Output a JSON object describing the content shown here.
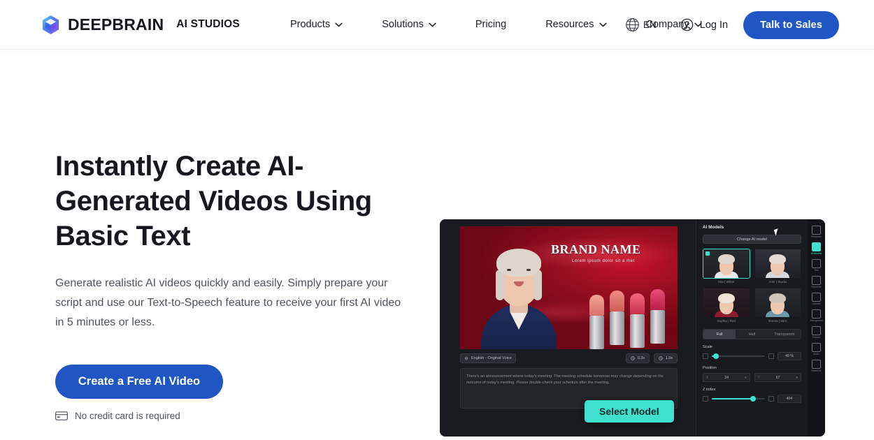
{
  "header": {
    "brand": {
      "name": "DEEPBRAIN",
      "sub": "AI STUDIOS",
      "logo_icon": "cube-logo-icon"
    },
    "nav": [
      {
        "label": "Products",
        "has_dropdown": true
      },
      {
        "label": "Solutions",
        "has_dropdown": true
      },
      {
        "label": "Pricing",
        "has_dropdown": false
      },
      {
        "label": "Resources",
        "has_dropdown": true
      },
      {
        "label": "Company",
        "has_dropdown": true
      }
    ],
    "language": {
      "label": "EN",
      "icon": "globe-icon"
    },
    "login": {
      "label": "Log In",
      "icon": "user-circle-icon"
    },
    "cta": {
      "label": "Talk to Sales"
    }
  },
  "hero": {
    "title": "Instantly Create AI-Generated Videos Using Basic Text",
    "subtitle": "Generate realistic AI videos quickly and easily. Simply prepare your script and use our Text-to-Speech feature to receive your first AI video in 5 minutes or less.",
    "cta": {
      "label": "Create a Free AI Video"
    },
    "note": {
      "label": "No credit card is required",
      "icon": "credit-card-icon"
    }
  },
  "editor": {
    "stage": {
      "brand_name": "BRAND NAME",
      "brand_tagline": "Lorem ipsum dolor sit a met"
    },
    "toolbar": {
      "language_tag": "English - Original Voice",
      "duration_a": "0.3s",
      "duration_b": "1.0s"
    },
    "script": "There's an announcement where today's meeting. The meeting schedule tomorrow may change depending on the outcome of today's meeting. Please double-check your schedule after the meeting.",
    "select_model_button": "Select Model",
    "panel": {
      "title": "AI Models",
      "change_button": "Change AI model",
      "models": [
        {
          "name": "Mia | White",
          "selected": true
        },
        {
          "name": "Ariel | Studio",
          "selected": false
        },
        {
          "name": "Sophia | Red",
          "selected": false
        },
        {
          "name": "Emma | Mint",
          "selected": false
        }
      ],
      "segments": [
        {
          "label": "Full",
          "active": true
        },
        {
          "label": "Half",
          "active": false
        },
        {
          "label": "Transparent",
          "active": false
        }
      ],
      "scale": {
        "label": "Scale",
        "value": "49 %",
        "percent": 8
      },
      "position": {
        "label": "Position",
        "x_key": "X",
        "x_value": "24",
        "y_key": "Y",
        "y_value": "67"
      },
      "z_index": {
        "label": "Z index",
        "value": "404",
        "percent": 78
      }
    },
    "rail": [
      {
        "label": "Templates",
        "icon": "templates-icon",
        "active": false
      },
      {
        "label": "AI Models",
        "icon": "ai-models-icon",
        "active": true
      },
      {
        "label": "Text",
        "icon": "text-icon",
        "active": false
      },
      {
        "label": "Elements",
        "icon": "elements-icon",
        "active": false
      },
      {
        "label": "Uploads",
        "icon": "uploads-icon",
        "active": false
      },
      {
        "label": "Background",
        "icon": "background-icon",
        "active": false
      },
      {
        "label": "Frames",
        "icon": "frames-icon",
        "active": false
      },
      {
        "label": "Audio",
        "icon": "audio-icon",
        "active": false
      },
      {
        "label": "Brand Kit",
        "icon": "brand-kit-icon",
        "active": false
      }
    ]
  },
  "colors": {
    "brand_blue": "#1f56c3",
    "accent_teal": "#3fe0cd",
    "text_dark": "#16181d",
    "text_muted": "#4d525c",
    "editor_bg": "#121319"
  }
}
